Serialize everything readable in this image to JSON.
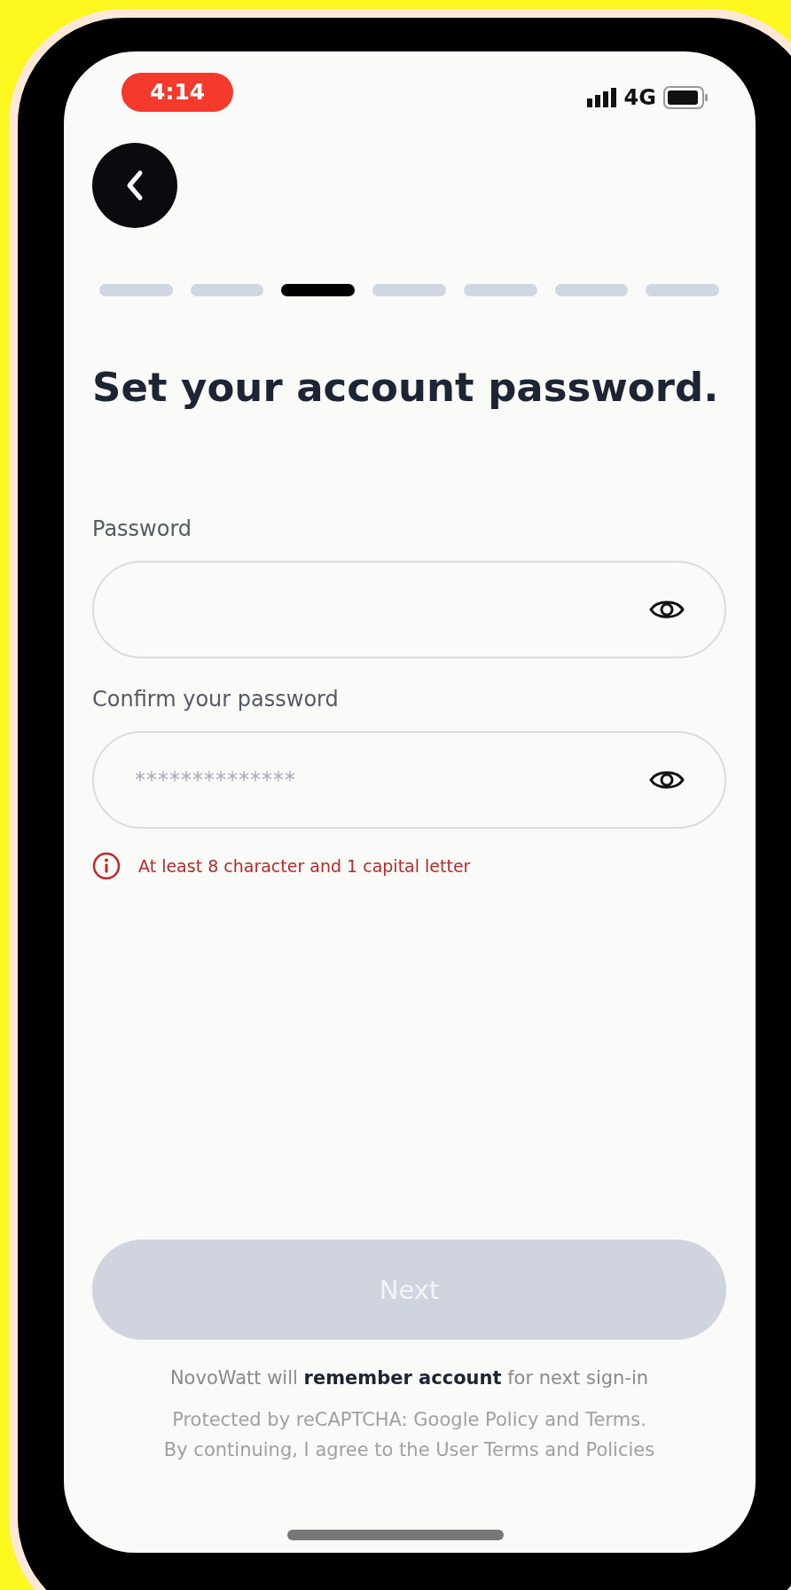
{
  "status_bar": {
    "time": "4:14",
    "network": "4G"
  },
  "progress": {
    "steps": [
      {
        "selected": false
      },
      {
        "selected": false
      },
      {
        "selected": true
      },
      {
        "selected": false
      },
      {
        "selected": false
      },
      {
        "selected": false
      },
      {
        "selected": false
      }
    ]
  },
  "title": "Set your account password.",
  "fields": [
    {
      "label": "Password"
    },
    {
      "label": "Confirm your password",
      "placeholder": "**************"
    }
  ],
  "error": "At least 8 character and 1 capital letter",
  "next_button": {
    "label": "Next",
    "disabled": true
  },
  "remember_note": "NovoWatt will **remember account** for next sign-in",
  "legal_lines": [
    "Protected by reCAPTCHA: Google Policy and Terms.",
    "By continuing, I agree to the User Terms and Policies"
  ]
}
